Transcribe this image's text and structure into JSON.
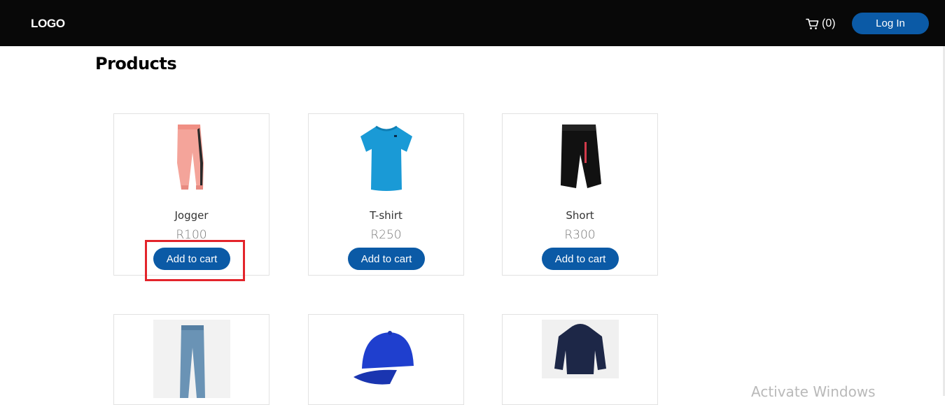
{
  "navbar": {
    "logo": "LOGO",
    "cart_count": "(0)",
    "cart_icon": "shopping-cart-icon",
    "login_label": "Log In",
    "accent": "#0b5aa6"
  },
  "main": {
    "title": "Products",
    "products": [
      {
        "name": "Jogger",
        "price": "R100",
        "button": "Add to cart",
        "image": "pink-jogger-pants"
      },
      {
        "name": "T-shirt",
        "price": "R250",
        "button": "Add to cart",
        "image": "blue-tshirt"
      },
      {
        "name": "Short",
        "price": "R300",
        "button": "Add to cart",
        "image": "black-shorts"
      },
      {
        "name": "",
        "price": "",
        "button": "",
        "image": "blue-jeans"
      },
      {
        "name": "",
        "price": "",
        "button": "",
        "image": "blue-cap"
      },
      {
        "name": "",
        "price": "",
        "button": "",
        "image": "navy-hoodie"
      }
    ]
  },
  "overlay": {
    "highlight_color": "#e3242b"
  },
  "watermark": "Activate Windows"
}
